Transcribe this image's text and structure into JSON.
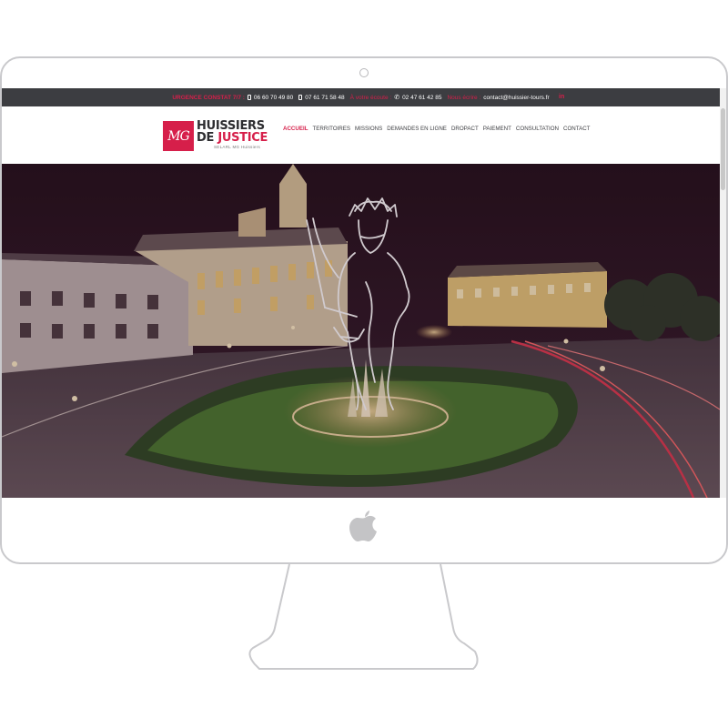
{
  "topbar": {
    "urgence_label": "URGENCE CONSTAT 7/7 :",
    "mobile_1": "06 60 70 49 80",
    "mobile_2": "07 61 71 58 48",
    "office_label": "À votre écoute :",
    "office_phone": "02 47 61 42 85",
    "email_label": "Nous écrire :",
    "email": "contact@huissier-tours.fr",
    "linkedin": "in"
  },
  "logo": {
    "mark": "MG",
    "line1": "HUISSIERS",
    "line2_a": "DE ",
    "line2_b": "JUSTICE",
    "subtitle": "SELARL MG Huissiers"
  },
  "nav": {
    "items": [
      {
        "label": "ACCUEIL",
        "active": true
      },
      {
        "label": "TERRITOIRES"
      },
      {
        "label": "MISSIONS"
      },
      {
        "label": "DEMANDES EN LIGNE"
      },
      {
        "label": "DROPACT"
      },
      {
        "label": "PAIEMENT"
      },
      {
        "label": "CONSULTATION"
      },
      {
        "label": "CONTACT"
      }
    ]
  },
  "colors": {
    "accent": "#d61f4a",
    "topbar_bg": "#3c3d41",
    "hero_sky": "#2a141f"
  },
  "icons": {
    "device_logo": "apple-logo-icon",
    "mobile": "mobile-phone-icon",
    "tel": "telephone-icon"
  }
}
